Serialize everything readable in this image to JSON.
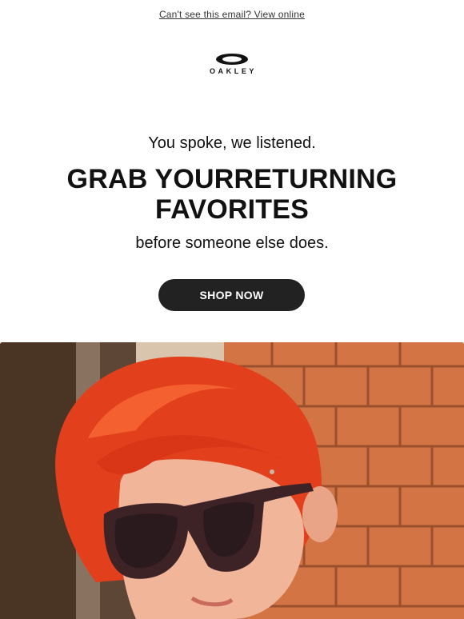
{
  "header": {
    "view_online_text": "Can't see this email? View online"
  },
  "logo": {
    "wordmark": "OAKLEY",
    "icon": "oakley-ellipse-logo-icon"
  },
  "hero": {
    "kicker": "You spoke, we listened.",
    "headline": "GRAB YOURRETURNING FAVORITES",
    "subline": "before someone else does.",
    "cta_label": "SHOP NOW"
  },
  "image": {
    "subject": "hero-photo-red-hair-sunglasses"
  },
  "colors": {
    "cta_background": "#222222",
    "text": "#111111",
    "brick": "#d97a4a",
    "hair": "#e8401e"
  }
}
